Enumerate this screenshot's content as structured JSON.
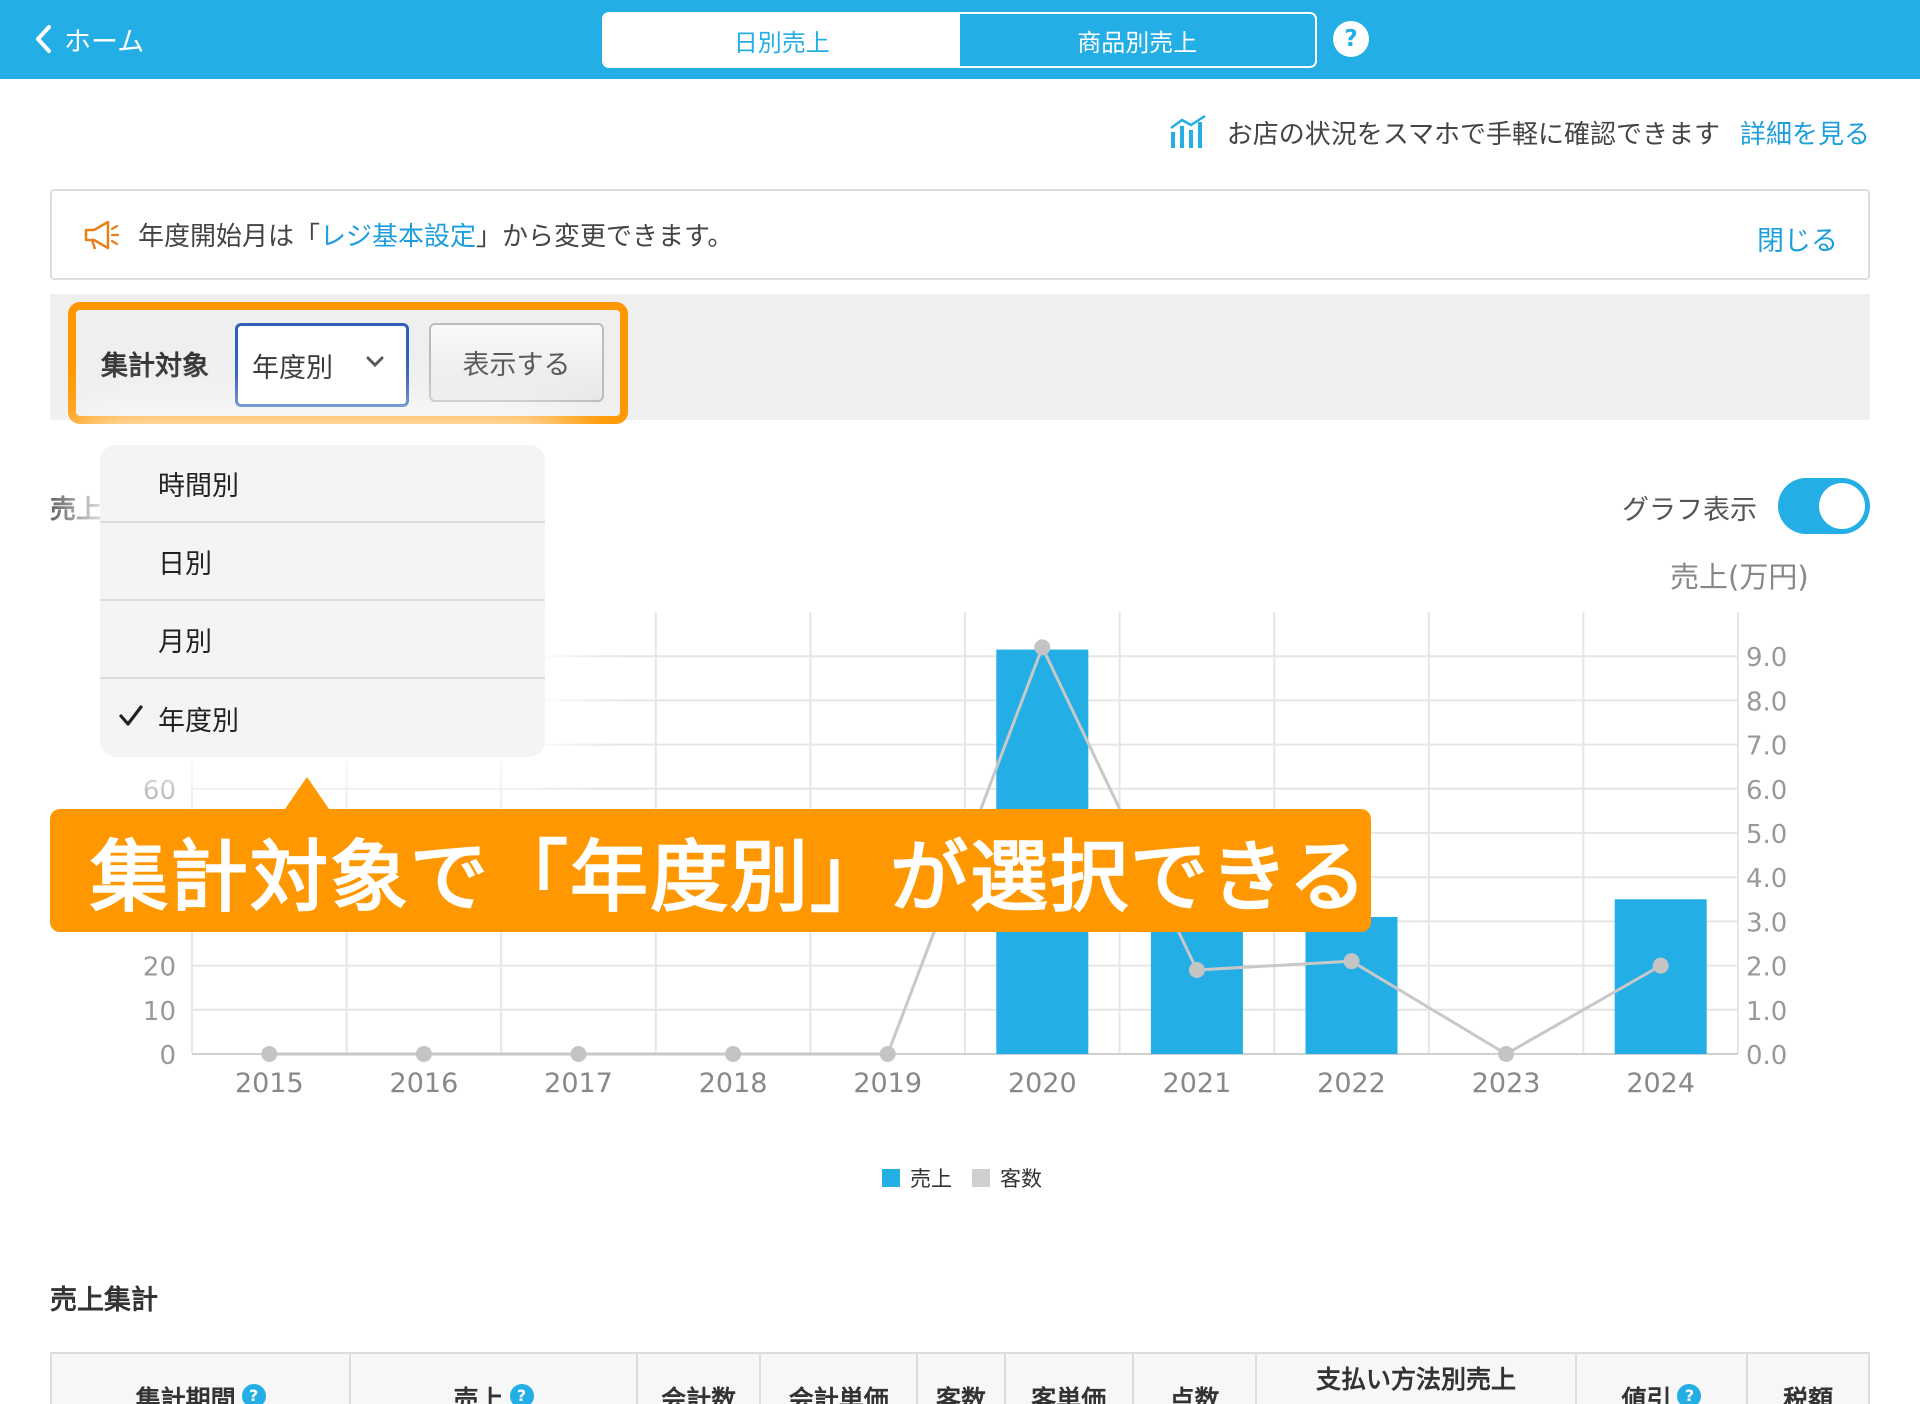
{
  "header": {
    "back_label": "ホーム",
    "tabs": [
      {
        "label": "日別売上",
        "active": true
      },
      {
        "label": "商品別売上",
        "active": false
      }
    ],
    "help_label": "?"
  },
  "promo": {
    "text": "お店の状況をスマホで手軽に確認できます",
    "link": "詳細を見る"
  },
  "notice": {
    "prefix": "年度開始月は「",
    "link": "レジ基本設定",
    "suffix": "」から変更できます。",
    "close": "閉じる"
  },
  "filter": {
    "label": "集計対象",
    "selected": "年度別",
    "show_button": "表示する"
  },
  "dropdown": {
    "options": [
      "時間別",
      "日別",
      "月別",
      "年度別"
    ],
    "checked": "年度別"
  },
  "callout": {
    "text": "集計対象で「年度別」が選択できる"
  },
  "section": {
    "sales_title_partial": "売上",
    "graph_toggle_label": "グラフ表示",
    "graph_toggle_on": true,
    "summary_title": "売上集計"
  },
  "colors": {
    "brand": "#23aee5",
    "callout": "#ff9800",
    "link": "#1e9fdc",
    "line": "#c8c8c8"
  },
  "chart_data": {
    "type": "bar",
    "categories": [
      "2015",
      "2016",
      "2017",
      "2018",
      "2019",
      "2020",
      "2021",
      "2022",
      "2023",
      "2024"
    ],
    "series": [
      {
        "name": "売上",
        "kind": "bar",
        "axis": "left",
        "values": [
          0,
          0,
          0,
          0,
          0,
          91.5,
          33,
          31,
          0,
          35
        ]
      },
      {
        "name": "客数",
        "kind": "line",
        "axis": "right",
        "values": [
          0,
          0,
          0,
          0,
          0,
          9.2,
          1.9,
          2.1,
          0,
          2.0
        ]
      }
    ],
    "y_left_ticks": [
      "0",
      "10",
      "20",
      "60"
    ],
    "y_right_ticks": [
      "0.0",
      "1.0",
      "2.0",
      "3.0",
      "4.0",
      "5.0",
      "6.0",
      "7.0",
      "8.0",
      "9.0"
    ],
    "ylim_left": [
      0,
      100
    ],
    "ylim_right": [
      0,
      10
    ],
    "y_right_title": "売上(万円)",
    "grid": true,
    "legend": "bottom-center"
  },
  "table": {
    "headers": [
      {
        "label": "集計期間",
        "help": true
      },
      {
        "label": "売上",
        "help": true
      },
      {
        "label": "会計数",
        "help": false
      },
      {
        "label": "会計単価",
        "help": false
      },
      {
        "label": "客数",
        "help": false
      },
      {
        "label": "客単価",
        "help": false
      },
      {
        "label": "点数",
        "help": false
      },
      {
        "label": "支払い方法別売上",
        "help": false
      },
      {
        "label": "値引",
        "help": true
      },
      {
        "label": "税額",
        "help": false
      }
    ]
  }
}
